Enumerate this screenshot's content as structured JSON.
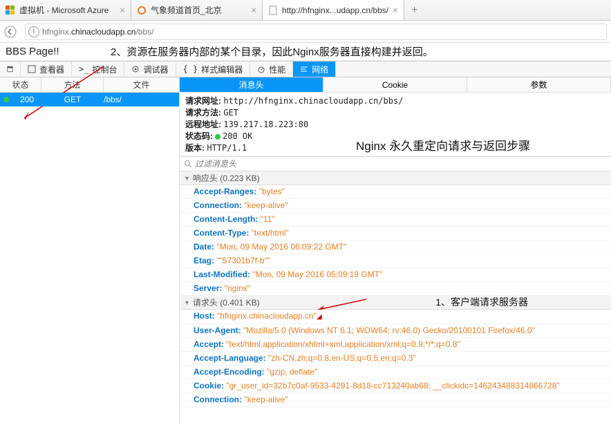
{
  "tabs": [
    {
      "title": "虚拟机 - Microsoft Azure",
      "favicon": "azure"
    },
    {
      "title": "气象频道首页_北京",
      "favicon": "swirl"
    },
    {
      "title": "http://hfnginx...udapp.cn/bbs/",
      "favicon": "blank",
      "active": true
    }
  ],
  "url": {
    "prefix": "hfnginx.",
    "domain": "chinacloudapp.cn",
    "path": "/bbs/"
  },
  "page_text": "BBS Page!!",
  "annotation2": "2、资源在服务器内部的某个目录，因此Nginx服务器直接构建并返回。",
  "annotation_nginx": "Nginx 永久重定向请求与返回步骤",
  "annotation1": "1、客户端请求服务器",
  "devtools": {
    "tabs": [
      "查看器",
      "控制台",
      "调试器",
      "样式编辑器",
      "性能",
      "网络"
    ],
    "active": "网络",
    "cols": {
      "status": "状态",
      "method": "方法",
      "file": "文件"
    },
    "sub_tabs": [
      "消息头",
      "Cookie",
      "参数"
    ],
    "request": {
      "status": "200",
      "method": "GET",
      "file": "/bbs/"
    }
  },
  "summary": {
    "url_label": "请求网址:",
    "url_val": "http://hfnginx.chinacloudapp.cn/bbs/",
    "method_label": "请求方法:",
    "method_val": "GET",
    "remote_label": "远程地址:",
    "remote_val": "139.217.18.223:80",
    "status_label": "状态码:",
    "status_val": "200 OK",
    "version_label": "版本:",
    "version_val": "HTTP/1.1"
  },
  "filter_placeholder": "过滤消息头",
  "resp_section": "响应头 (0.223 KB)",
  "response_headers": [
    {
      "k": "Accept-Ranges",
      "v": "\"bytes\""
    },
    {
      "k": "Connection",
      "v": "\"keep-alive\""
    },
    {
      "k": "Content-Length",
      "v": "\"11\""
    },
    {
      "k": "Content-Type",
      "v": "\"text/html\""
    },
    {
      "k": "Date",
      "v": "\"Mon, 09 May 2016 06:09:22 GMT\""
    },
    {
      "k": "Etag",
      "v": "\"\"57301b7f-b\"\""
    },
    {
      "k": "Last-Modified",
      "v": "\"Mon, 09 May 2016 05:09:19 GMT\""
    },
    {
      "k": "Server",
      "v": "\"nginx\""
    }
  ],
  "req_section": "请求头 (0.401 KB)",
  "request_headers": [
    {
      "k": "Host",
      "v": "\"hfnginx.chinacloudapp.cn\""
    },
    {
      "k": "User-Agent",
      "v": "\"Mozilla/5.0 (Windows NT 6.1; WOW64; rv:46.0) Gecko/20100101 Firefox/46.0\""
    },
    {
      "k": "Accept",
      "v": "\"text/html,application/xhtml+xml,application/xml;q=0.9,*/*;q=0.8\""
    },
    {
      "k": "Accept-Language",
      "v": "\"zh-CN,zh;q=0.8,en-US;q=0.5,en;q=0.3\""
    },
    {
      "k": "Accept-Encoding",
      "v": "\"gzip, deflate\""
    },
    {
      "k": "Cookie",
      "v": "\"gr_user_id=32b7c0af-9533-4291-8d18-cc713240ab68; __clickidc=146243488314866728\""
    },
    {
      "k": "Connection",
      "v": "\"keep-alive\""
    }
  ]
}
